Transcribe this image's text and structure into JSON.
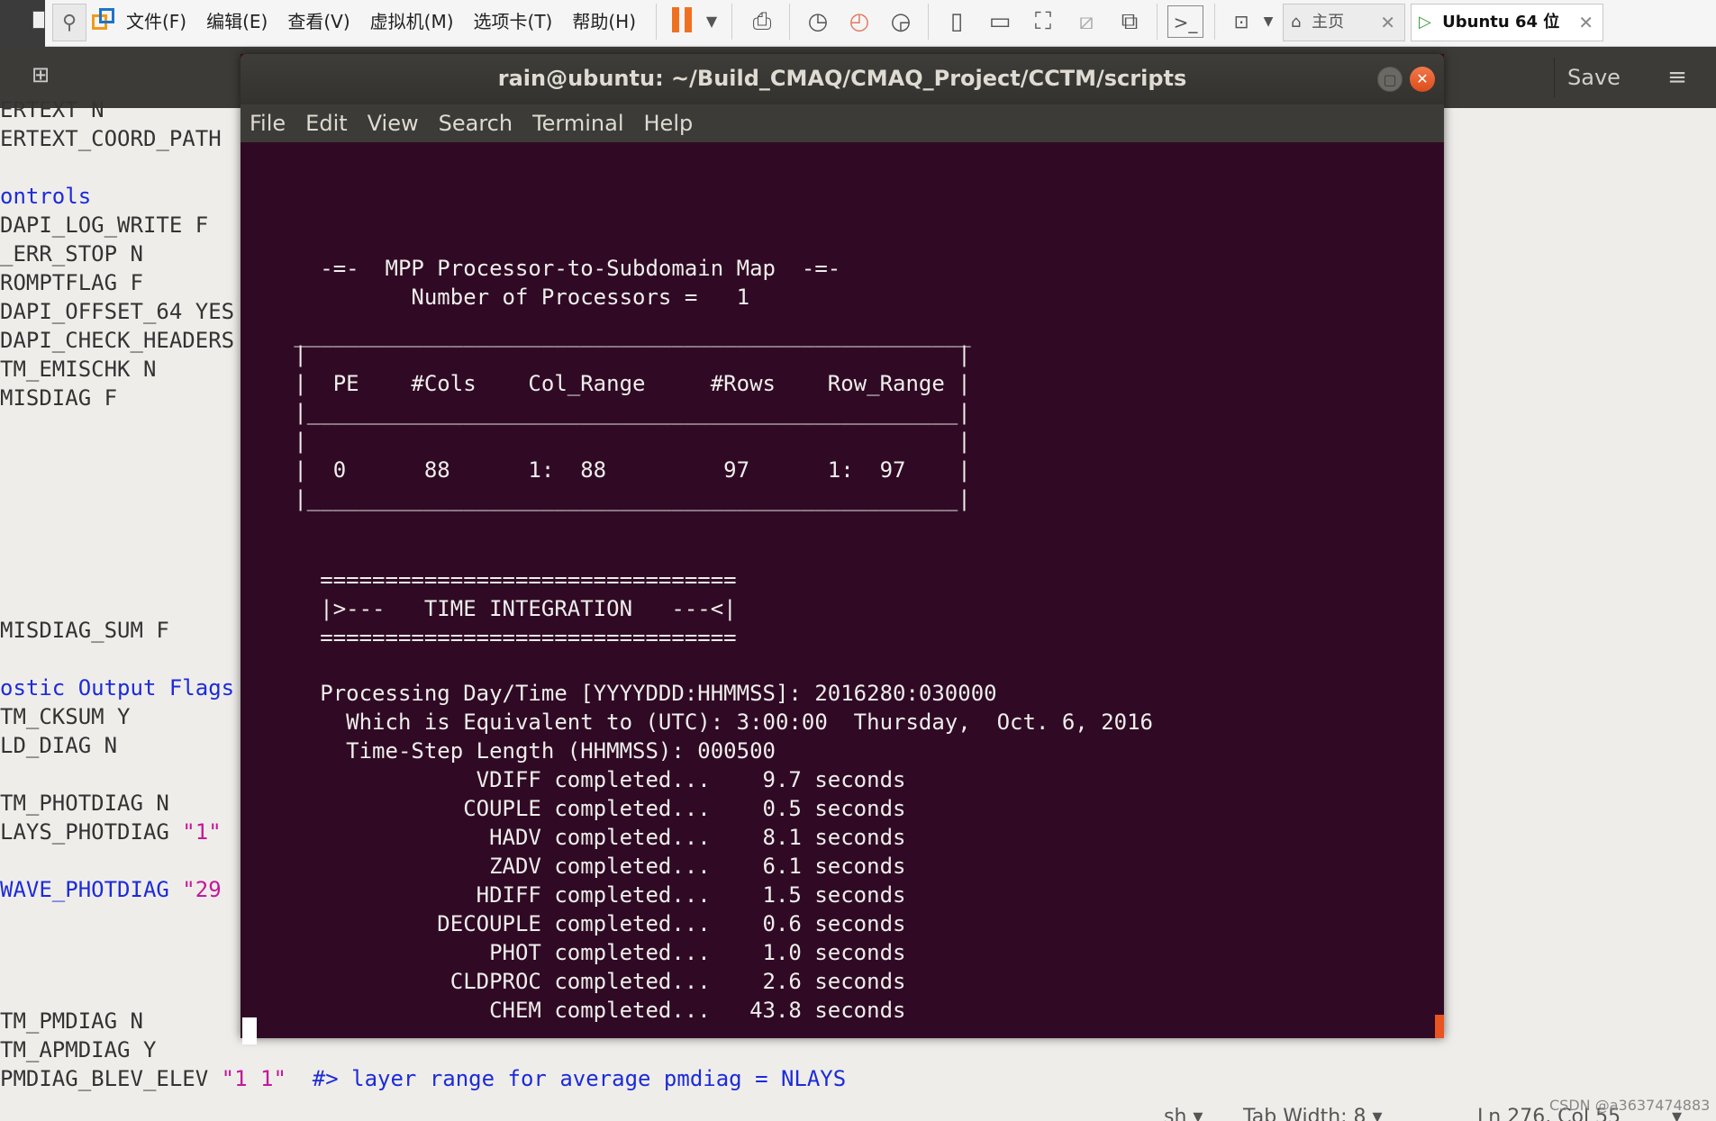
{
  "vm": {
    "menu": [
      "文件(F)",
      "编辑(E)",
      "查看(V)",
      "虚拟机(M)",
      "选项卡(T)",
      "帮助(H)"
    ],
    "tabs": [
      {
        "label": "主页",
        "close": "✕"
      },
      {
        "label": "Ubuntu 64 位",
        "close": "✕"
      }
    ]
  },
  "gedit": {
    "save_label": "Save",
    "menu_glyph": "≡",
    "lines": [
      {
        "text": "ERTEXT N",
        "color": "plain"
      },
      {
        "text": "ERTEXT_COORD_PATH",
        "color": "plain"
      },
      {
        "text": "ontrols",
        "color": "blue"
      },
      {
        "text": "DAPI_LOG_WRITE F",
        "color": "plain"
      },
      {
        "text": "_ERR_STOP N",
        "color": "plain"
      },
      {
        "text": "ROMPTFLAG F",
        "color": "plain"
      },
      {
        "text": "DAPI_OFFSET_64 YES",
        "color": "plain"
      },
      {
        "text": "DAPI_CHECK_HEADERS",
        "color": "plain"
      },
      {
        "text": "TM_EMISCHK N",
        "color": "plain"
      },
      {
        "text": "MISDIAG F",
        "color": "plain"
      },
      {
        "text": "MISDIAG_SUM F",
        "color": "plain"
      },
      {
        "text": "ostic Output Flags",
        "color": "blue"
      },
      {
        "text": "TM_CKSUM Y",
        "color": "plain"
      },
      {
        "text": "LD_DIAG N",
        "color": "plain"
      },
      {
        "text": "TM_PHOTDIAG N",
        "color": "plain"
      },
      {
        "text": "LAYS_PHOTDIAG ",
        "color": "plain",
        "extra": "\"1\"",
        "extra_color": "magenta"
      },
      {
        "text": "WAVE_PHOTDIAG ",
        "color": "blue",
        "extra": "\"29",
        "extra_color": "magenta"
      },
      {
        "text": "TM_PMDIAG N",
        "color": "plain"
      },
      {
        "text": "TM_APMDIAG Y",
        "color": "plain"
      },
      {
        "text": "PMDIAG_BLEV_ELEV ",
        "color": "plain",
        "extra": "\"1 1\"",
        "extra_color": "magenta",
        "comment": "  #> layer range for average pmdiag = NLAYS"
      }
    ],
    "status": {
      "lang": "sh ▾",
      "tab_width": "Tab Width: 8 ▾",
      "position": "Ln 276, Col 55",
      "ins": "▾"
    },
    "watermark": "CSDN @a3637474883"
  },
  "terminal": {
    "title": "rain@ubuntu: ~/Build_CMAQ/CMAQ_Project/CCTM/scripts",
    "menu": [
      "File",
      "Edit",
      "View",
      "Search",
      "Terminal",
      "Help"
    ],
    "lines": [
      "     -=-  MPP Processor-to-Subdomain Map  -=-",
      "            Number of Processors =   1",
      "   ____________________________________________________",
      "   |                                                  |",
      "   |  PE    #Cols    Col_Range     #Rows    Row_Range |",
      "   |__________________________________________________|",
      "   |                                                  |",
      "   |  0      88      1:  88         97      1:  97    |",
      "   |__________________________________________________|",
      "",
      "",
      "",
      "",
      "     ================================",
      "     |>---   TIME INTEGRATION   ---<|",
      "     ================================",
      "",
      "     Processing Day/Time [YYYYDDD:HHMMSS]: 2016280:030000",
      "       Which is Equivalent to (UTC): 3:00:00  Thursday,  Oct. 6, 2016",
      "       Time-Step Length (HHMMSS): 000500",
      "                 VDIFF completed...    9.7 seconds",
      "                COUPLE completed...    0.5 seconds",
      "                  HADV completed...    8.1 seconds",
      "                  ZADV completed...    6.1 seconds",
      "                 HDIFF completed...    1.5 seconds",
      "              DECOUPLE completed...    0.6 seconds",
      "                  PHOT completed...    1.0 seconds",
      "               CLDPROC completed...    2.6 seconds",
      "                  CHEM completed...   43.8 seconds"
    ]
  }
}
